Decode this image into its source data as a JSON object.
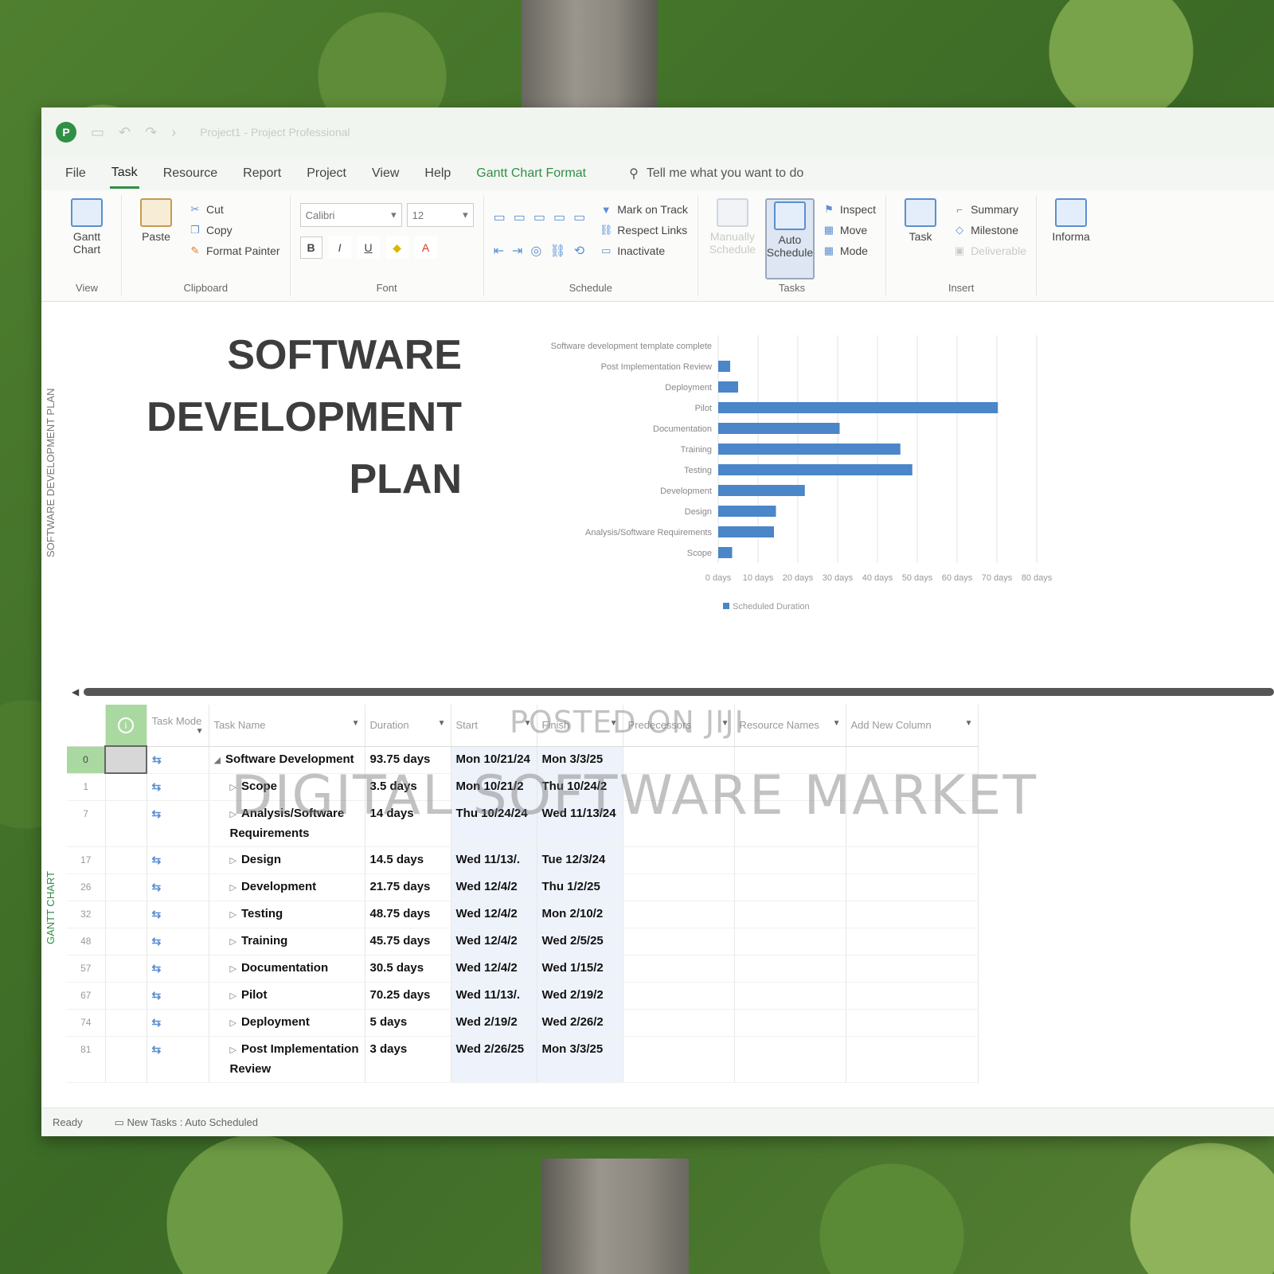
{
  "window": {
    "title_dim": "Project1  -  Project Professional"
  },
  "menu": {
    "tabs": [
      "File",
      "Task",
      "Resource",
      "Report",
      "Project",
      "View",
      "Help",
      "Gantt Chart Format"
    ],
    "active": "Task",
    "tellme": "Tell me what you want to do"
  },
  "ribbon": {
    "view": {
      "gantt": "Gantt Chart",
      "label": "View"
    },
    "clipboard": {
      "paste": "Paste",
      "cut": "Cut",
      "copy": "Copy",
      "format_painter": "Format Painter",
      "label": "Clipboard"
    },
    "font": {
      "family": "Calibri",
      "size": "12",
      "bold": "B",
      "italic": "I",
      "underline": "U",
      "label": "Font"
    },
    "schedule": {
      "mark_on_track": "Mark on Track",
      "respect_links": "Respect Links",
      "inactivate": "Inactivate",
      "label": "Schedule"
    },
    "tasks": {
      "manually": "Manually Schedule",
      "auto": "Auto Schedule",
      "inspect": "Inspect",
      "move": "Move",
      "mode": "Mode",
      "label": "Tasks"
    },
    "insert": {
      "task": "Task",
      "summary": "Summary",
      "milestone": "Milestone",
      "deliverable": "Deliverable",
      "label": "Insert"
    },
    "properties": {
      "information": "Informa"
    }
  },
  "page": {
    "side_label_top": "SOFTWARE DEVELOPMENT PLAN",
    "title": "SOFTWARE\nDEVELOPMENT\nPLAN",
    "side_label_bottom": "GANTT CHART"
  },
  "chart_data": {
    "type": "bar",
    "orientation": "horizontal",
    "categories": [
      "Software development template complete",
      "Post Implementation Review",
      "Deployment",
      "Pilot",
      "Documentation",
      "Training",
      "Testing",
      "Development",
      "Design",
      "Analysis/Software Requirements",
      "Scope"
    ],
    "series": [
      {
        "name": "Scheduled Duration",
        "values": [
          0,
          3,
          5,
          70.25,
          30.5,
          45.75,
          48.75,
          21.75,
          14.5,
          14,
          3.5
        ]
      }
    ],
    "xlim": [
      0,
      80
    ],
    "tick_labels": [
      "0 days",
      "10 days",
      "20 days",
      "30 days",
      "40 days",
      "50 days",
      "60 days",
      "70 days",
      "80 days"
    ],
    "grid": true,
    "legend": "bottom-left",
    "color": "#4a86c8"
  },
  "grid": {
    "headers": [
      "Task Mode",
      "Task Name",
      "Duration",
      "Start",
      "Finish",
      "Predecessors",
      "Resource Names",
      "Add New Column"
    ],
    "rows": [
      {
        "id": "0",
        "name": "Software Development",
        "duration": "93.75 days",
        "start": "Mon 10/21/24",
        "finish": "Mon 3/3/25",
        "summary": true
      },
      {
        "id": "1",
        "name": "Scope",
        "duration": "3.5 days",
        "start": "Mon 10/21/2",
        "finish": "Thu 10/24/2"
      },
      {
        "id": "7",
        "name": "Analysis/Software Requirements",
        "duration": "14 days",
        "start": "Thu 10/24/24",
        "finish": "Wed 11/13/24"
      },
      {
        "id": "17",
        "name": "Design",
        "duration": "14.5 days",
        "start": "Wed 11/13/.",
        "finish": "Tue 12/3/24"
      },
      {
        "id": "26",
        "name": "Development",
        "duration": "21.75 days",
        "start": "Wed 12/4/2",
        "finish": "Thu 1/2/25"
      },
      {
        "id": "32",
        "name": "Testing",
        "duration": "48.75 days",
        "start": "Wed 12/4/2",
        "finish": "Mon 2/10/2"
      },
      {
        "id": "48",
        "name": "Training",
        "duration": "45.75 days",
        "start": "Wed 12/4/2",
        "finish": "Wed 2/5/25"
      },
      {
        "id": "57",
        "name": "Documentation",
        "duration": "30.5 days",
        "start": "Wed 12/4/2",
        "finish": "Wed 1/15/2"
      },
      {
        "id": "67",
        "name": "Pilot",
        "duration": "70.25 days",
        "start": "Wed 11/13/.",
        "finish": "Wed 2/19/2"
      },
      {
        "id": "74",
        "name": "Deployment",
        "duration": "5 days",
        "start": "Wed 2/19/2",
        "finish": "Wed 2/26/2"
      },
      {
        "id": "81",
        "name": "Post Implementation Review",
        "duration": "3 days",
        "start": "Wed 2/26/25",
        "finish": "Mon 3/3/25"
      }
    ]
  },
  "status": {
    "ready": "Ready",
    "new_tasks": "New Tasks : Auto Scheduled"
  },
  "watermark": {
    "line1": "POSTED ON JIJI",
    "line2": "DIGITAL SOFTWARE MARKET"
  }
}
